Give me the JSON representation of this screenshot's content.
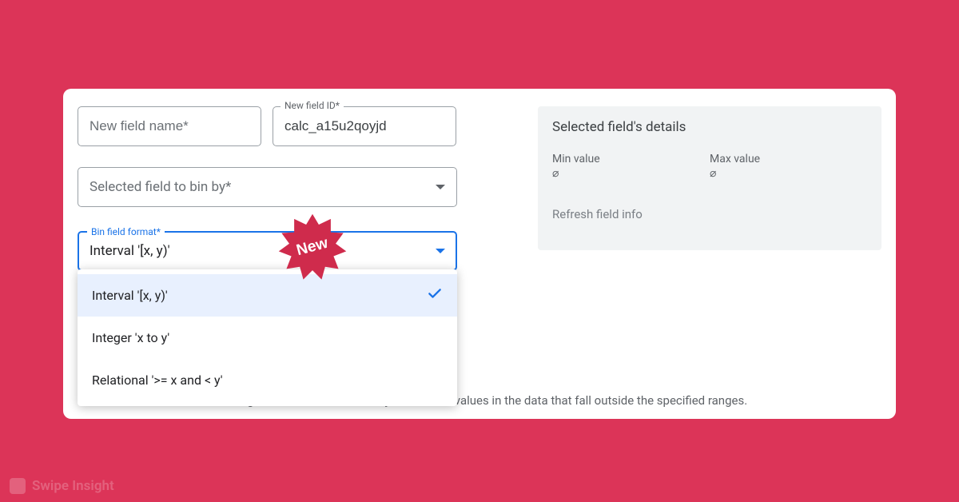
{
  "colors": {
    "accent_blue": "#1a73e8",
    "badge_bg": "#cf2b4c"
  },
  "inputs": {
    "new_field_name_placeholder": "New field name*",
    "new_field_id_label": "New field ID*",
    "new_field_id_value": "calc_a15u2qoyjd"
  },
  "select_bin_by": {
    "placeholder": "Selected field to bin by*"
  },
  "bin_format": {
    "label": "Bin field format*",
    "selected": "Interval '[x, y)'",
    "options": [
      "Interval '[x, y)'",
      "Integer 'x to y'",
      "Relational '>= x and < y'"
    ]
  },
  "help_text": "Customise the bin sizes and ranges. Bins are automatically created for values in the data that fall outside the specified ranges.",
  "details": {
    "title": "Selected field's details",
    "min_label": "Min value",
    "min_value": "⌀",
    "max_label": "Max value",
    "max_value": "⌀",
    "refresh": "Refresh field info"
  },
  "badge": {
    "text": "New"
  },
  "watermark": "Swipe Insight"
}
